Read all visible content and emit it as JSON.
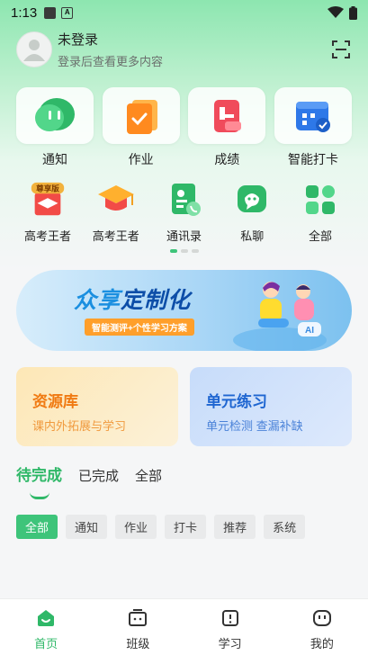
{
  "status_bar": {
    "time": "1:13"
  },
  "profile": {
    "name": "未登录",
    "subtitle": "登录后查看更多内容"
  },
  "main_tiles": [
    {
      "label": "通知",
      "icon": "message-bubble-icon"
    },
    {
      "label": "作业",
      "icon": "homework-icon"
    },
    {
      "label": "成绩",
      "icon": "grade-report-icon"
    },
    {
      "label": "智能打卡",
      "icon": "calendar-checkin-icon"
    }
  ],
  "shortcuts": [
    {
      "label": "高考王者",
      "icon": "graduation-cap-icon",
      "badge": "尊享版"
    },
    {
      "label": "高考王者",
      "icon": "graduation-cap-icon",
      "badge": ""
    },
    {
      "label": "通讯录",
      "icon": "contacts-icon",
      "badge": ""
    },
    {
      "label": "私聊",
      "icon": "chat-icon",
      "badge": ""
    },
    {
      "label": "全部",
      "icon": "grid-all-icon",
      "badge": ""
    }
  ],
  "carousel": {
    "pages": 3,
    "active": 0
  },
  "banner": {
    "title_a": "众享",
    "title_b": "定制化",
    "subtitle": "智能测评+个性学习方案"
  },
  "cards": {
    "resource": {
      "title": "资源库",
      "subtitle": "课内外拓展与学习"
    },
    "unit": {
      "title": "单元练习",
      "subtitle": "单元检测 查漏补缺"
    }
  },
  "tabs": [
    "待完成",
    "已完成",
    "全部"
  ],
  "filters": [
    "全部",
    "通知",
    "作业",
    "打卡",
    "推荐",
    "系统"
  ],
  "bottom_nav": [
    {
      "label": "首页",
      "icon": "home-icon"
    },
    {
      "label": "班级",
      "icon": "class-icon"
    },
    {
      "label": "学习",
      "icon": "study-icon"
    },
    {
      "label": "我的",
      "icon": "profile-icon"
    }
  ],
  "colors": {
    "accent": "#3ec47a",
    "accent_text": "#2fb868",
    "resource": "#f07a12",
    "unit": "#1f66d1"
  }
}
